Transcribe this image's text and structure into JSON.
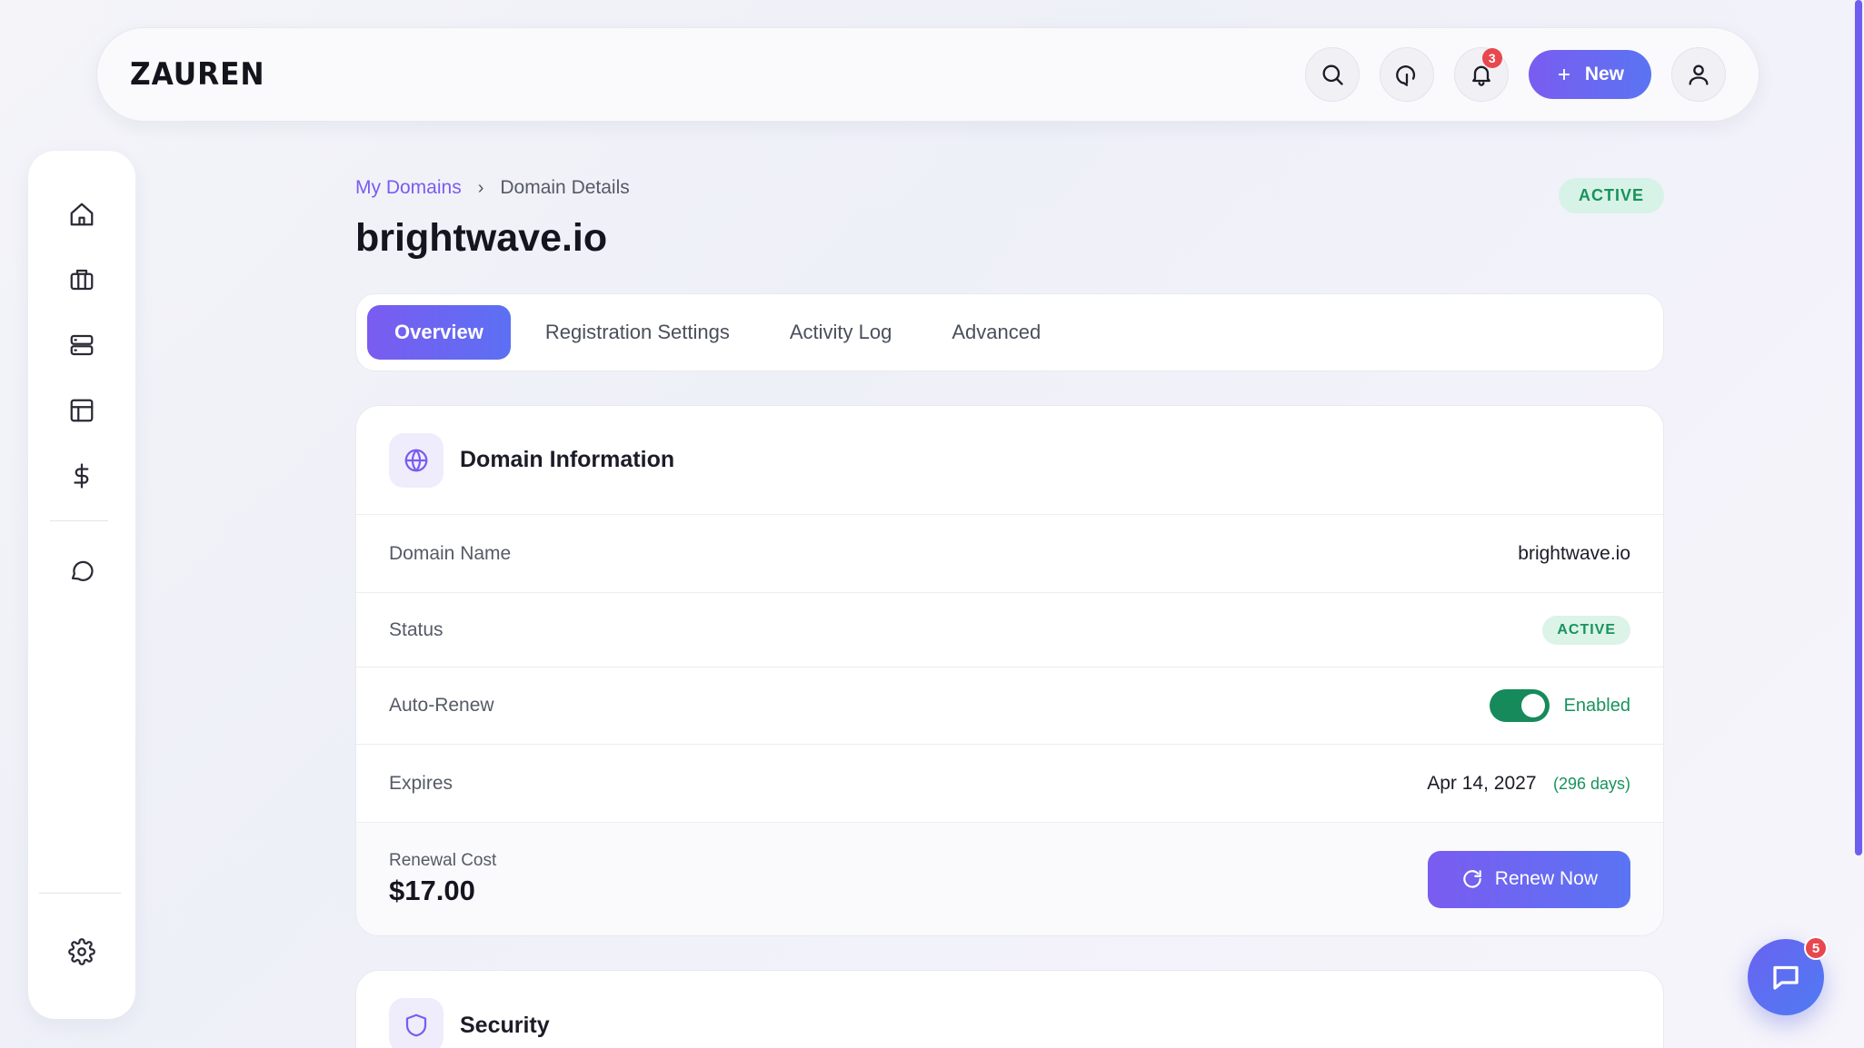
{
  "header": {
    "logo": "ZAUREN",
    "notification_count": "3",
    "new_button_label": "New",
    "icons": [
      "search-icon",
      "history-icon",
      "bell-icon",
      "plus-icon",
      "user-icon"
    ]
  },
  "sidebar": {
    "items": [
      {
        "name": "home",
        "icon": "home-icon"
      },
      {
        "name": "briefcase",
        "icon": "briefcase-icon"
      },
      {
        "name": "servers",
        "icon": "server-icon"
      },
      {
        "name": "layout",
        "icon": "layout-icon"
      },
      {
        "name": "billing",
        "icon": "dollar-icon"
      },
      {
        "name": "support",
        "icon": "message-icon"
      },
      {
        "name": "settings",
        "icon": "gear-icon"
      }
    ]
  },
  "breadcrumb": {
    "parent": "My Domains",
    "separator": "›",
    "current": "Domain Details"
  },
  "page": {
    "title": "brightwave.io",
    "status_badge": "ACTIVE"
  },
  "tabs": [
    {
      "label": "Overview",
      "active": true
    },
    {
      "label": "Registration Settings",
      "active": false
    },
    {
      "label": "Activity Log",
      "active": false
    },
    {
      "label": "Advanced",
      "active": false
    }
  ],
  "domain_info": {
    "title": "Domain Information",
    "rows": {
      "domain_name": {
        "label": "Domain Name",
        "value": "brightwave.io"
      },
      "status": {
        "label": "Status",
        "value": "ACTIVE"
      },
      "auto_renew": {
        "label": "Auto-Renew",
        "value": "Enabled",
        "on": true
      },
      "expires": {
        "label": "Expires",
        "value": "Apr 14, 2027",
        "days": "(296 days)"
      }
    },
    "renewal": {
      "label": "Renewal Cost",
      "cost": "$17.00",
      "button_label": "Renew Now"
    }
  },
  "security": {
    "title": "Security"
  },
  "chat": {
    "badge_count": "5"
  },
  "colors": {
    "accent": "#7a5cf0",
    "accent2": "#5a74f3",
    "success": "#17935c",
    "danger": "#e8474e"
  }
}
